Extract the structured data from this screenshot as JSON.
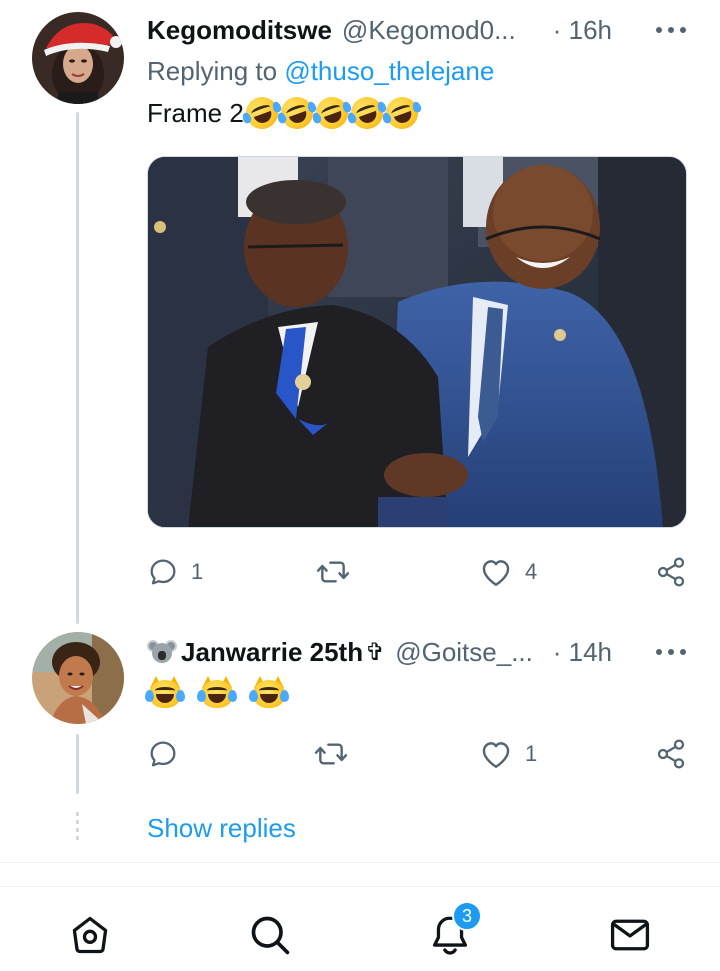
{
  "tweets": [
    {
      "display_name": "Kegomoditswe",
      "handle": "@Kegomod0...",
      "time": "· 16h",
      "replying_prefix": "Replying to",
      "replying_to": "@thuso_thelejane",
      "text": "Frame 2",
      "emoji": [
        "rolling-on-floor-laughing",
        "rolling-on-floor-laughing",
        "rolling-on-floor-laughing",
        "rolling-on-floor-laughing",
        "rolling-on-floor-laughing"
      ],
      "reply_count": "1",
      "retweet_count": "",
      "like_count": "4"
    },
    {
      "display_name": "Janwarrie 25th",
      "name_prefix_emoji": "koala",
      "name_suffix_glyph": "✞",
      "handle": "@Goitse_...",
      "time": "· 14h",
      "emoji": [
        "cat-tears-of-joy",
        "cat-tears-of-joy",
        "cat-tears-of-joy"
      ],
      "reply_count": "",
      "retweet_count": "",
      "like_count": "1"
    }
  ],
  "show_replies": "Show replies",
  "bottom_nav": {
    "items": [
      "home-icon",
      "search-icon",
      "notifications-icon",
      "messages-icon"
    ],
    "notifications_badge": "3"
  },
  "colors": {
    "accent": "#1d9bf0",
    "text_primary": "#0f1419",
    "text_secondary": "#536471",
    "thread_line": "#cfd9de"
  }
}
